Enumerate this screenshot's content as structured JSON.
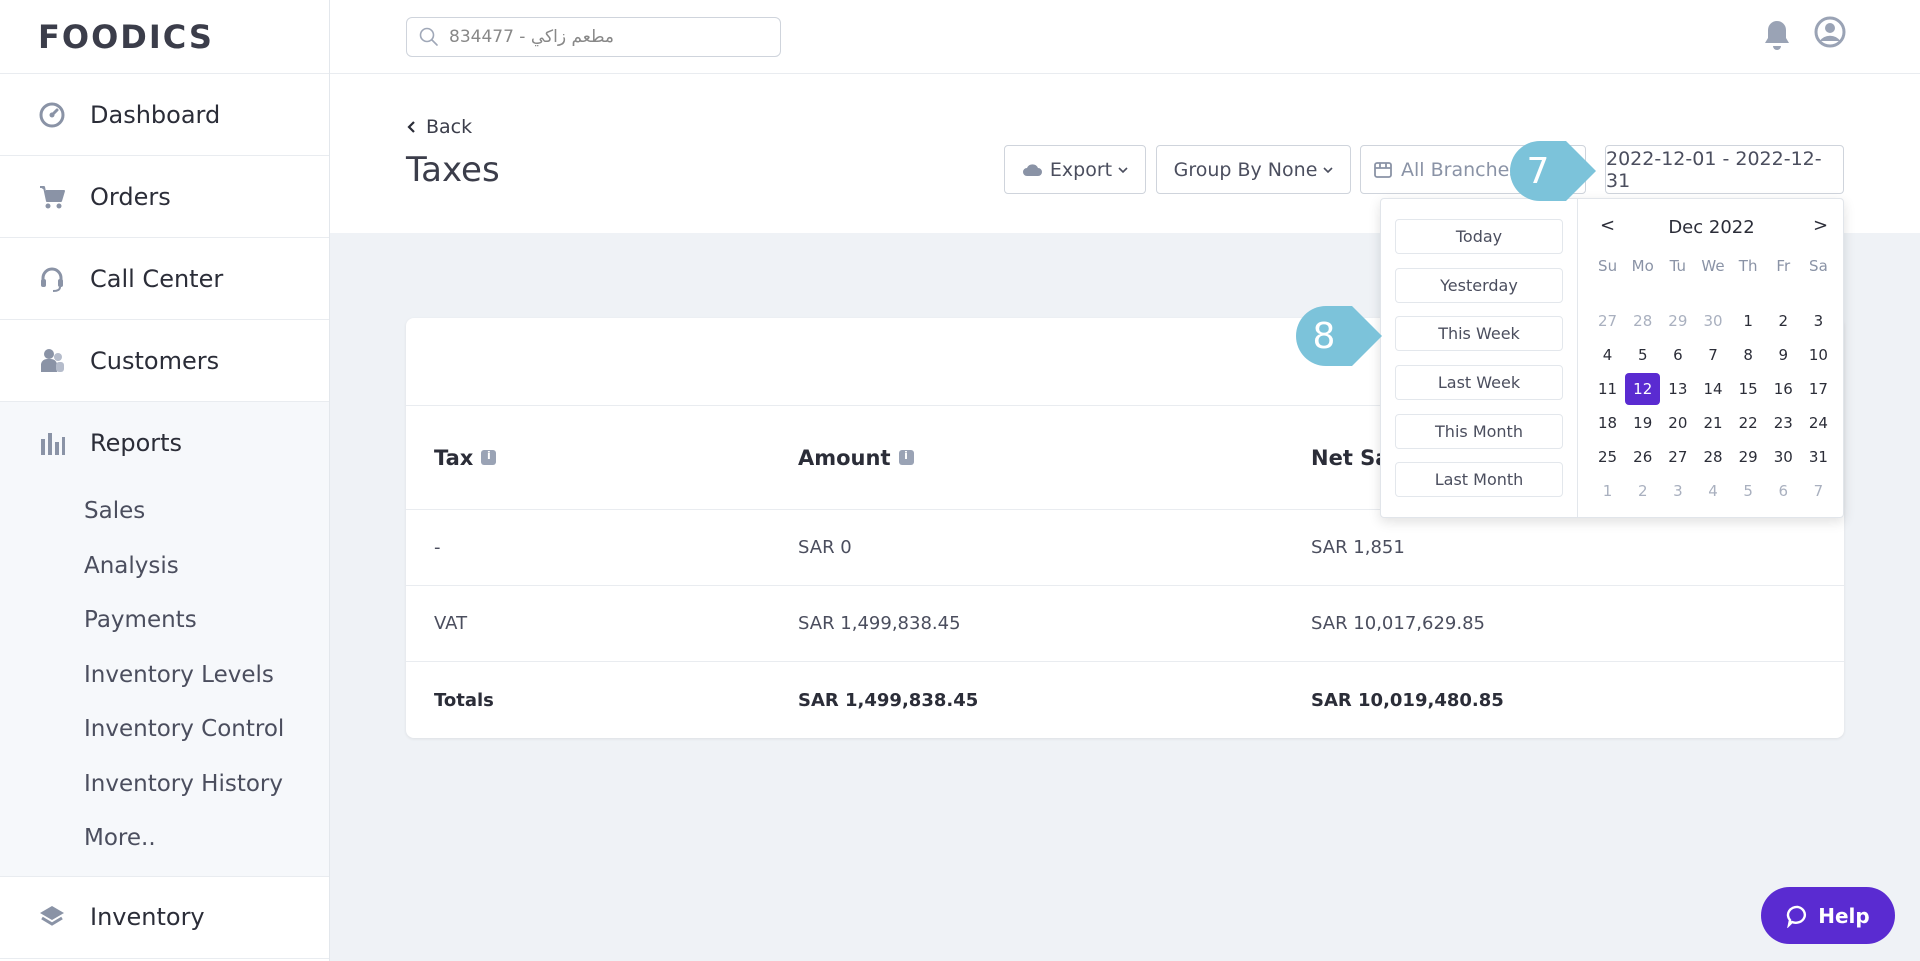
{
  "app": {
    "logo": "FOODICS"
  },
  "sidebar": {
    "items": [
      {
        "label": "Dashboard",
        "icon": "dashboard-icon"
      },
      {
        "label": "Orders",
        "icon": "cart-icon"
      },
      {
        "label": "Call Center",
        "icon": "headset-icon"
      },
      {
        "label": "Customers",
        "icon": "customers-icon"
      },
      {
        "label": "Reports",
        "icon": "bar-chart-icon"
      },
      {
        "label": "Inventory",
        "icon": "layers-icon"
      }
    ],
    "report_subitems": [
      "Sales",
      "Analysis",
      "Payments",
      "Inventory Levels",
      "Inventory Control",
      "Inventory History",
      "More.."
    ]
  },
  "header": {
    "search_value": "834477 - مطعم زاكي",
    "icons": [
      "bell-icon",
      "user-avatar-icon"
    ]
  },
  "page": {
    "back_label": "Back",
    "title": "Taxes",
    "export_label": "Export",
    "group_label": "Group By None",
    "branches_label": "All Branches",
    "date_range": "2022-12-01 - 2022-12-31"
  },
  "table": {
    "headers": [
      "Tax",
      "Amount",
      "Net Sa"
    ],
    "rows": [
      [
        "-",
        "SAR 0",
        "SAR 1,851"
      ],
      [
        "VAT",
        "SAR 1,499,838.45",
        "SAR 10,017,629.85"
      ]
    ],
    "totals": [
      "Totals",
      "SAR 1,499,838.45",
      "SAR 10,019,480.85"
    ]
  },
  "date_picker": {
    "presets": [
      "Today",
      "Yesterday",
      "This Week",
      "Last Week",
      "This Month",
      "Last Month"
    ],
    "month_label": "Dec 2022",
    "prev": "<",
    "next": ">",
    "weekdays": [
      "Su",
      "Mo",
      "Tu",
      "We",
      "Th",
      "Fr",
      "Sa"
    ],
    "weeks": [
      [
        "27",
        "28",
        "29",
        "30",
        "1",
        "2",
        "3"
      ],
      [
        "4",
        "5",
        "6",
        "7",
        "8",
        "9",
        "10"
      ],
      [
        "11",
        "12",
        "13",
        "14",
        "15",
        "16",
        "17"
      ],
      [
        "18",
        "19",
        "20",
        "21",
        "22",
        "23",
        "24"
      ],
      [
        "25",
        "26",
        "27",
        "28",
        "29",
        "30",
        "31"
      ],
      [
        "1",
        "2",
        "3",
        "4",
        "5",
        "6",
        "7"
      ]
    ],
    "selected_day": "12"
  },
  "callouts": {
    "step7": "7",
    "step8": "8"
  },
  "help": {
    "label": "Help"
  },
  "colors": {
    "accent": "#5a2bd1",
    "callout": "#7cc3da"
  }
}
